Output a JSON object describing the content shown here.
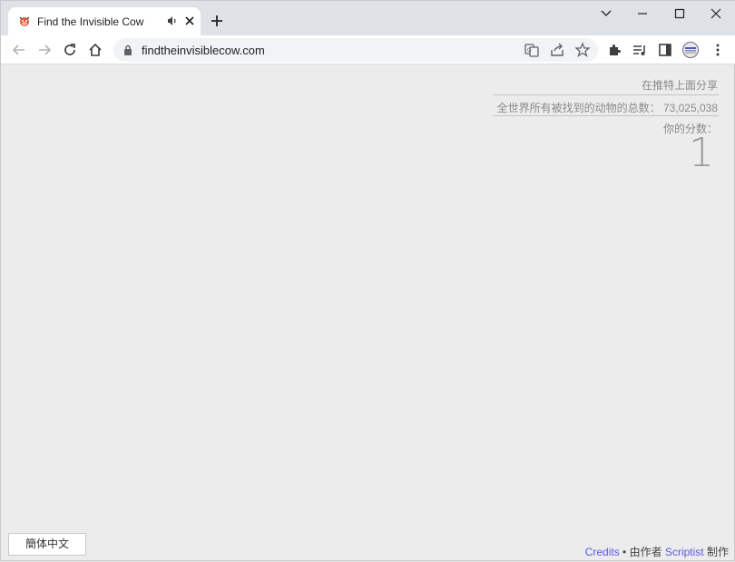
{
  "tab": {
    "title": "Find the Invisible Cow"
  },
  "omnibox": {
    "url": "findtheinvisiblecow.com"
  },
  "page": {
    "share_label": "在推特上面分享",
    "total_label": "全世界所有被找到的动物的总数：",
    "total_value": "73,025,038",
    "score_label": "你的分数：",
    "score_value": "1",
    "language_button": "簡体中文",
    "footer": {
      "credits": "Credits",
      "bullet": "•",
      "made_by_pre": "由作者",
      "author": "Scriptist",
      "made_by_post": "制作"
    }
  },
  "colors": {
    "page_bg": "#ececec",
    "link": "#5a5ae6",
    "tabstrip": "#dee1e6"
  },
  "icons": {
    "favicon": "cow-icon",
    "audio": "speaker-icon",
    "close": "close-icon",
    "new_tab": "plus-icon",
    "back": "back-arrow-icon",
    "forward": "forward-arrow-icon",
    "reload": "reload-icon",
    "home": "home-icon",
    "lock": "lock-icon",
    "translate": "translate-icon",
    "share": "share-icon",
    "bookmark": "star-icon",
    "extensions": "puzzle-icon",
    "media": "media-control-icon",
    "side_panel": "side-panel-icon",
    "profile": "profile-avatar-icon",
    "menu": "kebab-menu-icon"
  }
}
